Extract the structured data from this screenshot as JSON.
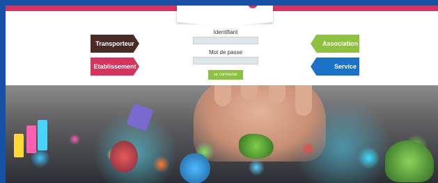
{
  "header": {
    "brand_color": "#d8335c"
  },
  "roles": {
    "transporteur": {
      "label": "Transporteur",
      "color": "#4a2a24"
    },
    "etablissement": {
      "label": "Etablissement",
      "color": "#d8335c"
    },
    "association": {
      "label": "Association",
      "color": "#8dc240"
    },
    "service": {
      "label": "Service",
      "color": "#1a73c8"
    }
  },
  "login": {
    "identifiant_label": "Identifiant",
    "password_label": "Mot de passe",
    "identifiant_value": "",
    "password_value": "",
    "submit_label": "se connecter"
  },
  "banner": {
    "description_icon": "hand-with-objects-image"
  }
}
